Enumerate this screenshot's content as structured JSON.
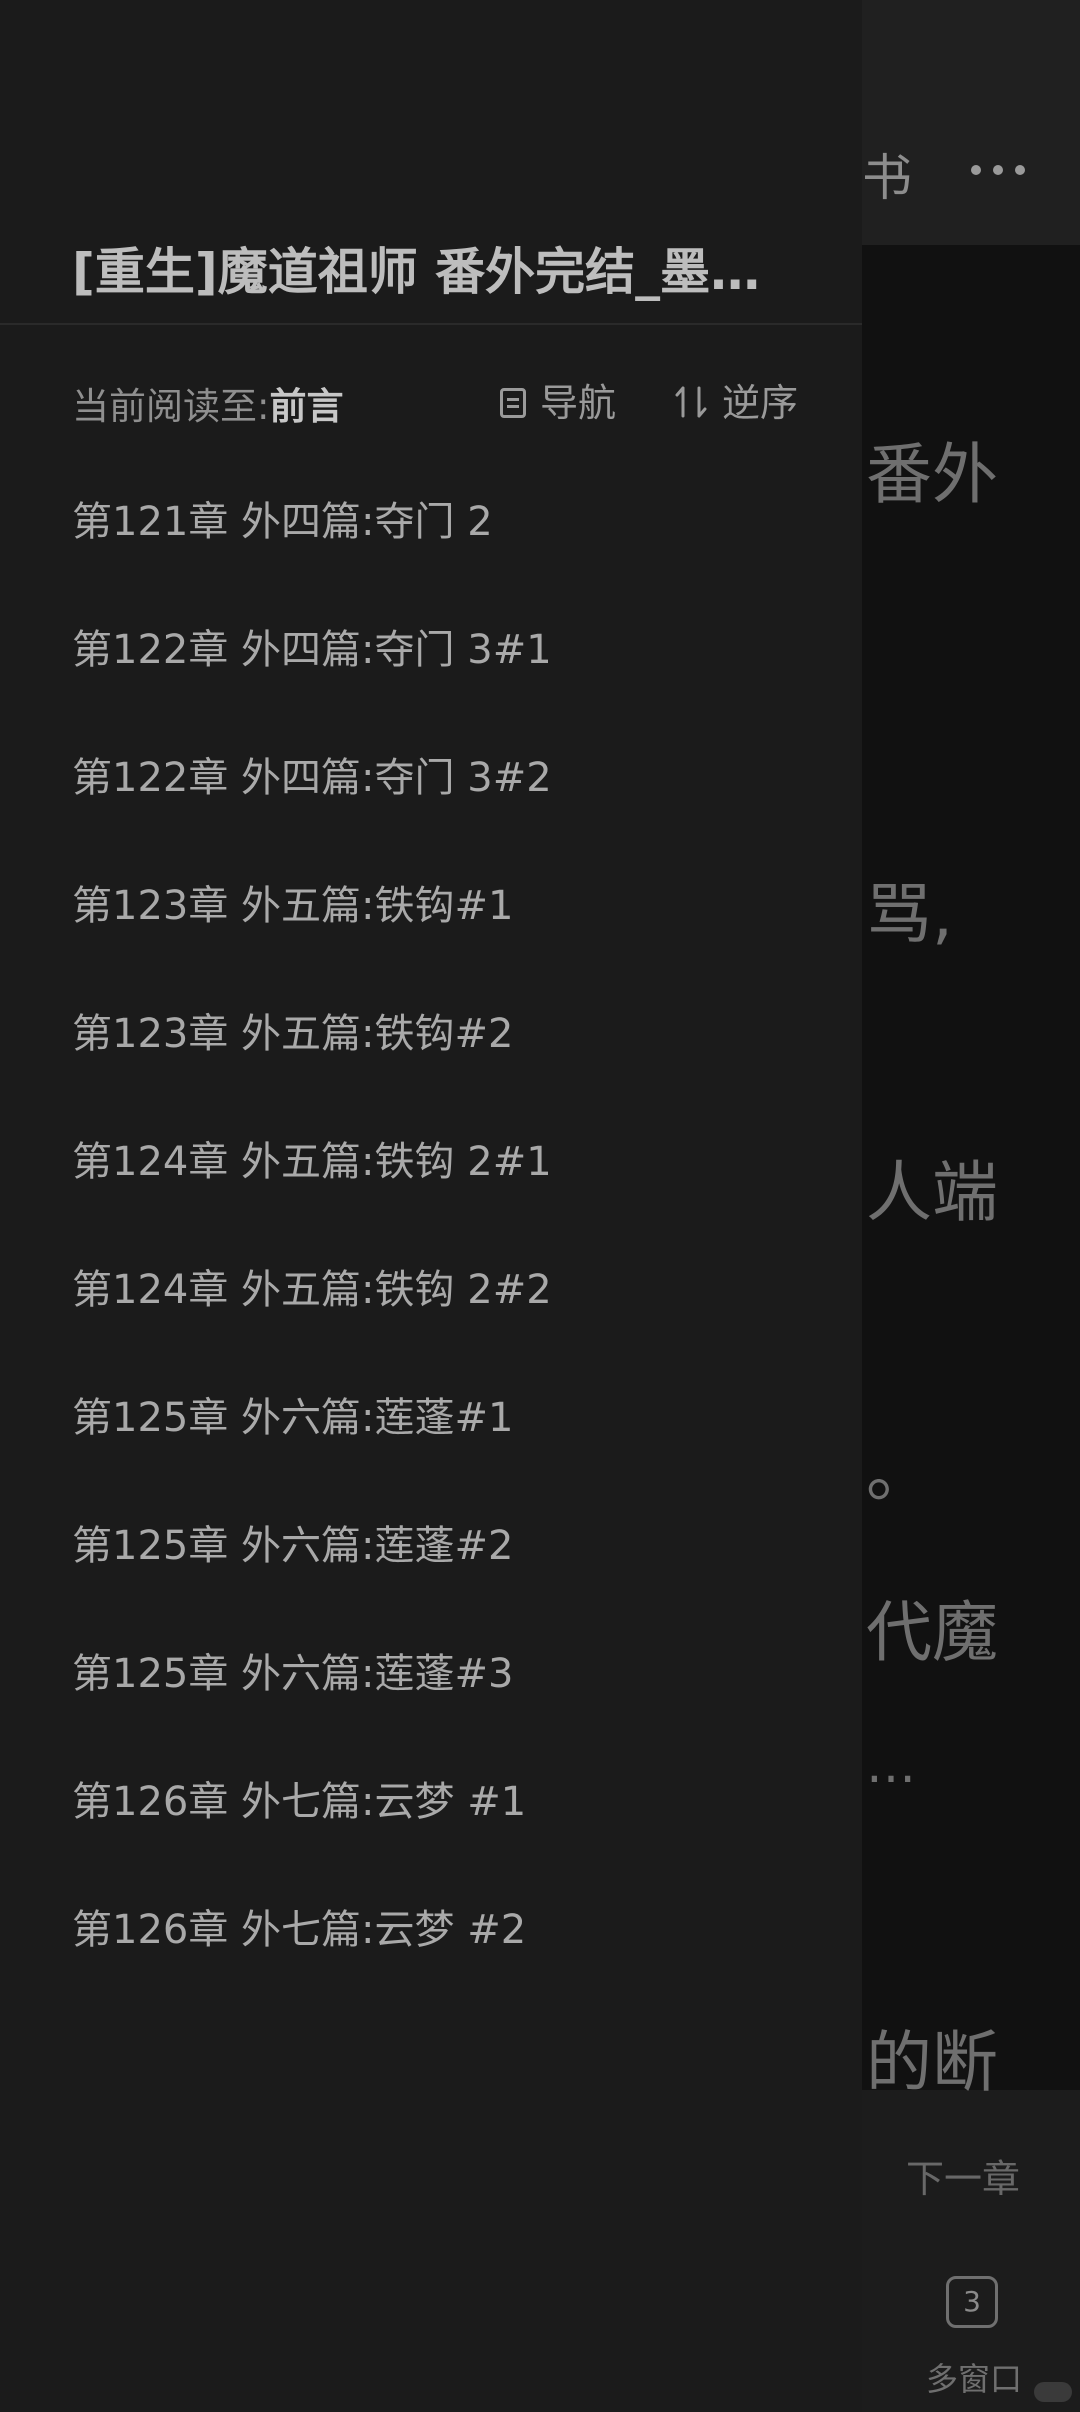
{
  "reader": {
    "top_label": "书",
    "text_lines": [
      "番外",
      "骂,",
      "人端",
      "。",
      "代魔",
      "…",
      "的断"
    ],
    "next_chapter_label": "下一章",
    "window_count": "3",
    "window_label": "多窗口"
  },
  "drawer": {
    "title": "[重生]魔道祖师 番外完结_墨…",
    "progress_label": "当前阅读至:",
    "progress_value": "前言",
    "nav_label": "导航",
    "sort_label": "逆序",
    "chapters": [
      "第121章 外四篇:夺门 2",
      "第122章 外四篇:夺门 3#1",
      "第122章 外四篇:夺门 3#2",
      "第123章 外五篇:铁钩#1",
      "第123章 外五篇:铁钩#2",
      "第124章 外五篇:铁钩 2#1",
      "第124章 外五篇:铁钩 2#2",
      "第125章 外六篇:莲蓬#1",
      "第125章 外六篇:莲蓬#2",
      "第125章 外六篇:莲蓬#3",
      "第126章 外七篇:云梦 #1",
      "第126章 外七篇:云梦 #2"
    ]
  },
  "colors": {
    "background": "#1b1b1b",
    "reader_page": "#111111",
    "chapter_text": "#a9a9a9",
    "title_text": "#bdbdbd"
  }
}
